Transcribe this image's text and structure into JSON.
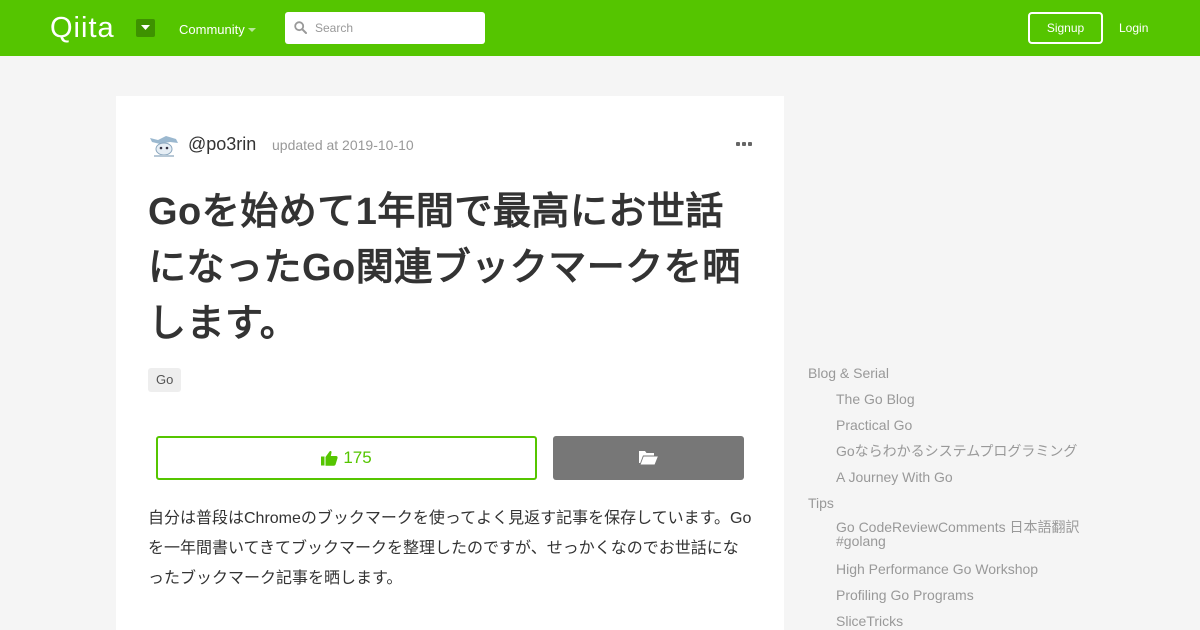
{
  "header": {
    "logo": "Qiita",
    "community_label": "Community",
    "search_placeholder": "Search",
    "signup_label": "Signup",
    "login_label": "Login"
  },
  "article": {
    "username": "@po3rin",
    "updated": "updated at 2019-10-10",
    "title": "Goを始めて1年間で最高にお世話になったGo関連ブックマークを晒します。",
    "tag": "Go",
    "like_count": "175",
    "body": "自分は普段はChromeのブックマークを使ってよく見返す記事を保存しています。Goを一年間書いてきてブックマークを整理したのですが、せっかくなのでお世話になったブックマーク記事を晒します。"
  },
  "toc": {
    "sections": [
      {
        "heading": "Blog & Serial",
        "items": [
          "The Go Blog",
          "Practical Go",
          "Goならわかるシステムプログラミング",
          "A Journey With Go"
        ]
      },
      {
        "heading": "Tips",
        "items": [
          "Go CodeReviewComments 日本語翻訳 #golang",
          "High Performance Go Workshop",
          "Profiling Go Programs",
          "SliceTricks"
        ]
      }
    ]
  },
  "colors": {
    "brand": "#55c500",
    "stock_button": "#777777"
  }
}
